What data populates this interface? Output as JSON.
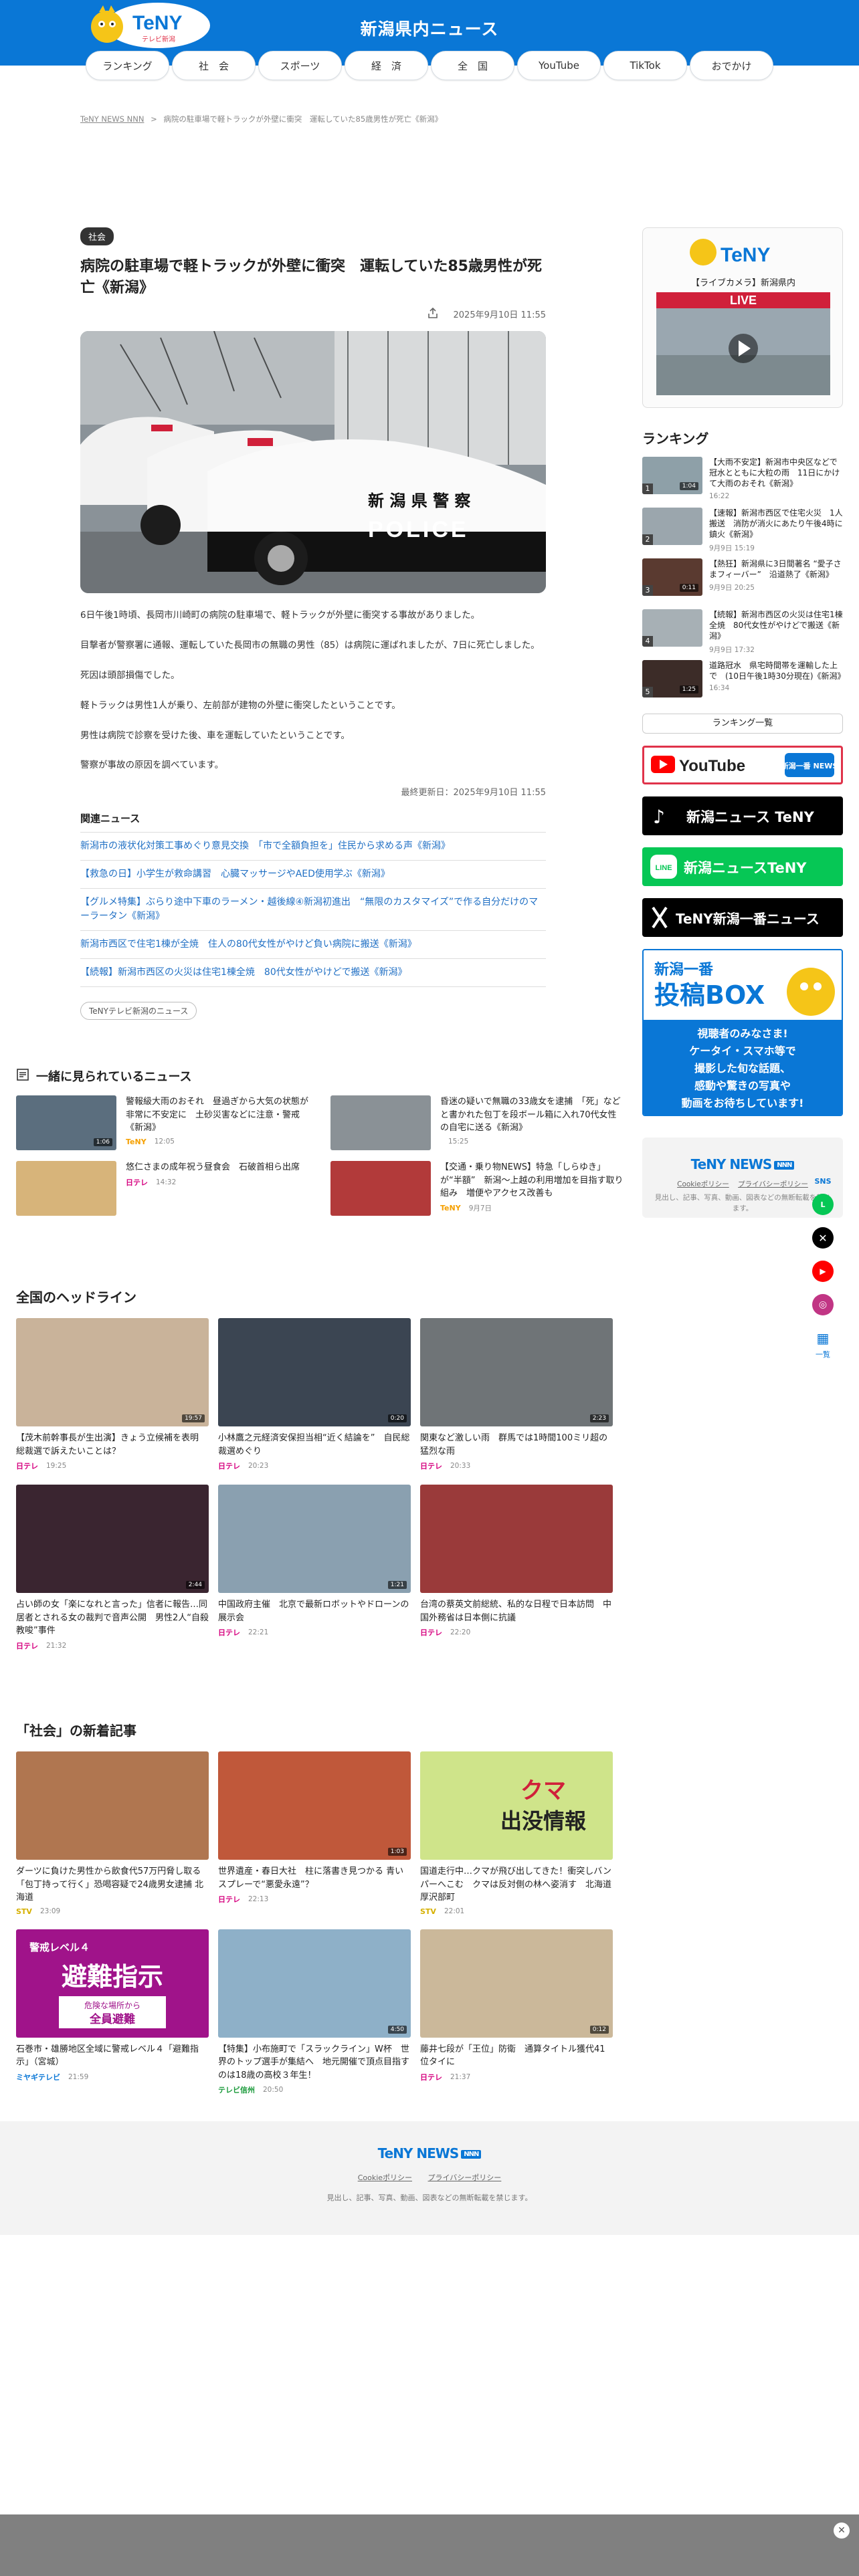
{
  "header": {
    "logo_text": "TeNY",
    "logo_sub": "テレビ新潟",
    "site_title": "新潟県内ニュース",
    "nav": [
      "ランキング",
      "社　会",
      "スポーツ",
      "経　済",
      "全　国",
      "YouTube",
      "TikTok",
      "おでかけ"
    ]
  },
  "breadcrumb": {
    "home": "TeNY NEWS NNN",
    "sep": ">",
    "current": "病院の駐車場で軽トラックが外壁に衝突　運転していた85歳男性が死亡《新潟》"
  },
  "article": {
    "category": "社会",
    "title": "病院の駐車場で軽トラックが外壁に衝突　運転していた85歳男性が死亡《新潟》",
    "published": "2025年9月10日 11:55",
    "hero_sign": "新 潟 県 警 察",
    "hero_police": "POLICE",
    "paragraphs": [
      "6日午後1時頃、長岡市川崎町の病院の駐車場で、軽トラックが外壁に衝突する事故がありました。",
      "目撃者が警察署に通報、運転していた長岡市の無職の男性（85）は病院に運ばれましたが、7日に死亡しました。",
      "死因は頭部損傷でした。",
      "軽トラックは男性1人が乗り、左前部が建物の外壁に衝突したということです。",
      "男性は病院で診察を受けた後、車を運転していたということです。",
      "警察が事故の原因を調べています。"
    ],
    "updated": "最終更新日：2025年9月10日 11:55",
    "related_heading": "関連ニュース",
    "related": [
      "新潟市の液状化対策工事めぐり意見交換　「市で全額負担を」住民から求める声《新潟》",
      "【救急の日】小学生が救命講習　心臓マッサージやAED使用学ぶ《新潟》",
      "【グルメ特集】ぶらり途中下車のラーメン・越後線④新潟初進出　“無限のカスタマイズ”で作る自分だけのマーラータン《新潟》",
      "新潟市西区で住宅1棟が全焼　住人の80代女性がやけど負い病院に搬送《新潟》",
      "【続報】新潟市西区の火災は住宅1棟全焼　80代女性がやけどで搬送《新潟》"
    ],
    "channel_label": "TeNYテレビ新潟のニュース"
  },
  "sidebar": {
    "live_label": "【ライブカメラ】新潟県内",
    "live_badge": "LIVE",
    "ranking_heading": "ランキング",
    "ranking": [
      {
        "num": "1",
        "dur": "1:04",
        "title": "【大雨不安定】新潟市中央区などで冠水とともに大粒の雨　11日にかけて大雨のおそれ《新潟》",
        "date": "16:22"
      },
      {
        "num": "2",
        "dur": "",
        "title": "【速報】新潟市西区で住宅火災　1人搬送　消防が消火にあたり午後4時に鎮火《新潟》",
        "date": "9月9日 15:19"
      },
      {
        "num": "3",
        "dur": "0:11",
        "title": "【熱狂】新潟県に3日間著名 “愛子さまフィーバー”　沿道熱了《新潟》",
        "date": "9月9日 20:25"
      },
      {
        "num": "4",
        "dur": "",
        "title": "【続報】新潟市西区の火災は住宅1棟全焼　80代女性がやけどで搬送《新潟》",
        "date": "9月9日 17:32"
      },
      {
        "num": "5",
        "dur": "1:25",
        "title": "道路冠水　県宅時間帯を運輸した上で　(10日午後1時30分現在)《新潟》",
        "date": "16:34"
      }
    ],
    "ranking_more": "ランキング一覧",
    "banners": {
      "youtube": "YouTube",
      "youtube_tag": "新潟一番 NEWS",
      "tiktok": "新潟ニュース TeNY",
      "line": "新潟ニュースTeNY",
      "x": "TeNY新潟一番ニュース"
    },
    "toukou": {
      "top": "新潟一番",
      "main": "投稿BOX",
      "l1": "視聴者のみなさま!",
      "l2": "ケータイ・スマホ等で",
      "l3": "撮影した旬な話題、",
      "l4": "感動や驚きの写真や",
      "l5": "動画をお待ちしています!"
    },
    "footer_logo": "TeNY NEWS",
    "footer_tag": "NNN",
    "footer_links": [
      "Cookieポリシー",
      "プライバシーポリシー"
    ],
    "footer_note": "見出し、記事、写真、動画、図表などの無断転載を禁じます。"
  },
  "social_rail": {
    "sns_label": "SNS",
    "more_label": "一覧"
  },
  "also_viewed": {
    "heading": "一緒に見られているニュース",
    "items": [
      {
        "title": "警報級大雨のおそれ　昼過ぎから大気の状態が非常に不安定に　土砂災害などに注意・警戒《新潟》",
        "src": "TeNY",
        "time": "12:05",
        "dur": "1:06"
      },
      {
        "title": "昏迷の疑いで無職の33歳女を逮捕　「死」などと書かれた包丁を段ボール箱に入れ70代女性の自宅に送る《新潟》",
        "src": "",
        "time": "15:25",
        "dur": ""
      },
      {
        "title": "悠仁さまの成年祝う昼食会　石破首相ら出席",
        "src": "日テレ",
        "time": "14:32",
        "dur": ""
      },
      {
        "title": "【交通・乗り物NEWS】特急「しらゆき」が“半額”　新潟〜上越の利用増加を目指す取り組み　増便やアクセス改善も",
        "src": "TeNY",
        "time": "9月7日",
        "dur": ""
      }
    ]
  },
  "national": {
    "heading": "全国のヘッドライン",
    "items": [
      {
        "title": "【茂木前幹事長が生出演】きょう立候補を表明　総裁選で訴えたいことは？",
        "src": "日テレ",
        "time": "19:25",
        "dur": "19:57"
      },
      {
        "title": "小林鷹之元経済安保担当相“近く結論を”　自民総裁選めぐり",
        "src": "日テレ",
        "time": "20:23",
        "dur": "0:20"
      },
      {
        "title": "関東など激しい雨　群馬では1時間100ミリ超の猛烈な雨",
        "src": "日テレ",
        "time": "20:33",
        "dur": "2:23"
      },
      {
        "title": "占い師の女「楽になれと言った」信者に報告…同居者とされる女の裁判で音声公開　男性2人“自殺教唆”事件",
        "src": "日テレ",
        "time": "21:32",
        "dur": "2:44"
      },
      {
        "title": "中国政府主催　北京で最新ロボットやドローンの展示会",
        "src": "日テレ",
        "time": "22:21",
        "dur": "1:21"
      },
      {
        "title": "台湾の蔡英文前総統、私的な日程で日本訪問　中国外務省は日本側に抗議",
        "src": "日テレ",
        "time": "22:20",
        "dur": ""
      }
    ]
  },
  "society": {
    "heading": "「社会」の新着記事",
    "items": [
      {
        "title": "ダーツに負けた男性から飲食代57万円脅し取る「包丁持って行く」恐喝容疑で24歳男女逮捕 北海道",
        "src": "STV",
        "time": "23:09",
        "dur": ""
      },
      {
        "title": "世界遺産・春日大社　柱に落書き見つかる 青いスプレーで“悪愛永遠”？",
        "src": "日テレ",
        "time": "22:13",
        "dur": "1:03"
      },
      {
        "title": "国道走行中…クマが飛び出してきた！衝突しバンパーへこむ　クマは反対側の林へ姿消す　北海道厚沢部町",
        "src": "STV",
        "time": "22:01",
        "dur": "",
        "sign1": "クマ",
        "sign2": "出没情報"
      },
      {
        "title": "石巻市・雄勝地区全域に警戒レベル４「避難指示」（宮城）",
        "src": "ミヤギテレビ",
        "time": "21:59",
        "dur": "",
        "lv": "警戒レベル４",
        "mark": "避難指示",
        "box1": "危険な場所から",
        "box2": "全員避難"
      },
      {
        "title": "【特集】小布施町で「スラックライン」W杯　世界のトップ選手が集結へ　地元開催で頂点目指すのは18歳の高校３年生！",
        "src": "テレビ信州",
        "time": "20:50",
        "dur": "4:50"
      },
      {
        "title": "藤井七段が「王位」防衛　通算タイトル獲代41位タイに",
        "src": "日テレ",
        "time": "21:37",
        "dur": "0:12"
      }
    ]
  },
  "footer": {
    "logo": "TeNY NEWS",
    "tag": "NNN",
    "links": [
      "Cookieポリシー",
      "プライバシーポリシー"
    ],
    "copy": "見出し、記事、写真、動画、図表などの無断転載を禁じます。"
  },
  "colors": {
    "brand": "#0a77d6",
    "link": "#1f6fc4",
    "nnn": "#d6007f"
  }
}
